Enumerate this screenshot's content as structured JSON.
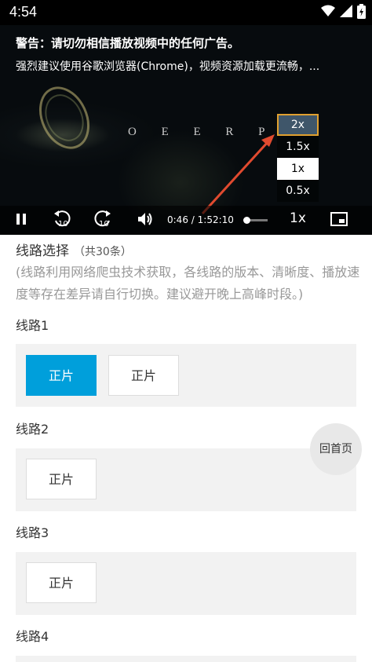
{
  "status_bar": {
    "time": "4:54",
    "icons": [
      "wifi-icon",
      "signal-icon",
      "battery-icon"
    ]
  },
  "player": {
    "warning_title": "警告：请切勿相信播放视频中的任何广告。",
    "warning_text": "强烈建议使用谷歌浏览器(Chrome)，视频资源加载更流畅，...",
    "video_title_text": "O  E E R P",
    "speed_options": [
      "2x",
      "1.5x",
      "1x",
      "0.5x"
    ],
    "speed_highlighted": "2x",
    "speed_current": "1x",
    "current_time": "0:46",
    "duration": "1:52:10",
    "time_separator": "/",
    "rate_label": "1x",
    "progress": 0.007,
    "icons": [
      "pause-icon",
      "rewind-10-icon",
      "forward-10-icon",
      "volume-icon",
      "picture-in-picture-icon"
    ],
    "arrow_color": "#e04a2f"
  },
  "routes": {
    "title": "线路选择",
    "count": "（共30条）",
    "description": "(线路利用网络爬虫技术获取，各线路的版本、清晰度、播放速度等存在差异请自行切换。建议避开晚上高峰时段。)",
    "lines": [
      {
        "label": "线路1",
        "episodes": [
          "正片",
          "正片"
        ],
        "active_index": 0
      },
      {
        "label": "线路2",
        "episodes": [
          "正片"
        ]
      },
      {
        "label": "线路3",
        "episodes": [
          "正片"
        ]
      },
      {
        "label": "线路4",
        "episodes": []
      }
    ]
  },
  "floating_button": {
    "label": "回首页"
  },
  "colors": {
    "accent": "#009fdb",
    "speed_highlight_border": "#e0a030"
  }
}
